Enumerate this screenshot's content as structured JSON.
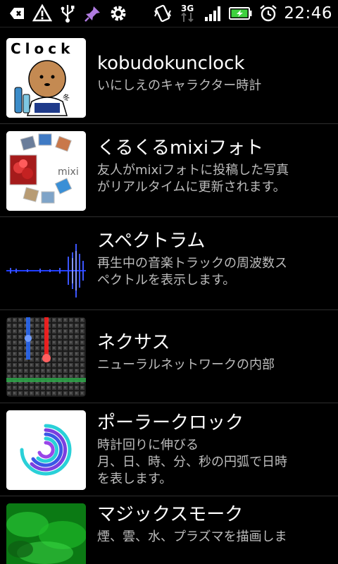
{
  "status": {
    "time": "22:46",
    "network": "3G",
    "left_icons": [
      "usb-debug-icon",
      "warning-icon",
      "usb-icon",
      "pin-icon",
      "settings-icon"
    ],
    "right_icons": [
      "vibrate-icon",
      "3g-icon",
      "signal-icon",
      "battery-charging-icon",
      "alarm-icon"
    ]
  },
  "items": [
    {
      "title": "kobudokunclock",
      "desc": [
        "いにしえのキャラクター時計"
      ],
      "thumb_text": "Clock",
      "thumb_sub": "冬"
    },
    {
      "title": "くるくるmixiフォト",
      "desc": [
        "友人がmixiフォトに投稿した写真",
        "がリアルタイムに更新されます。"
      ],
      "thumb_text": "mixi"
    },
    {
      "title": "スペクトラム",
      "desc": [
        "再生中の音楽トラックの周波数ス",
        "ペクトルを表示します。"
      ]
    },
    {
      "title": "ネクサス",
      "desc": [
        "ニューラルネットワークの内部"
      ]
    },
    {
      "title": "ポーラークロック",
      "desc": [
        "時計回りに伸びる",
        "月、日、時、分、秒の円弧で日時",
        "を表します。"
      ]
    },
    {
      "title": "マジックスモーク",
      "desc": [
        "煙、雲、水、プラズマを描画しま"
      ]
    }
  ],
  "colors": {
    "spectrum": "#1f3cff",
    "nexus_red": "#ff2020",
    "nexus_blue": "#2a6cff",
    "nexus_green": "#2ea84a",
    "smoke": "#1fbf2a",
    "battery": "#3fd23f"
  }
}
